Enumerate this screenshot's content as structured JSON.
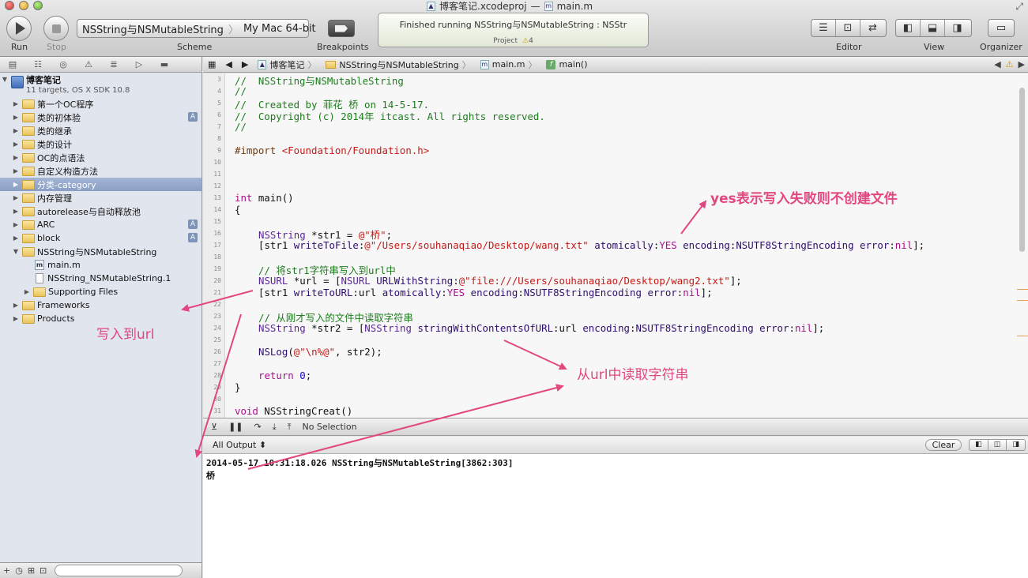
{
  "window": {
    "project_file": "博客笔记.xcodeproj",
    "separator": "—",
    "file_badge": "m",
    "file_name": "main.m",
    "fullscreen_glyph": "⤢"
  },
  "toolbar": {
    "run_label": "Run",
    "stop_label": "Stop",
    "scheme_label": "Scheme",
    "breakpoints_label": "Breakpoints",
    "editor_label": "Editor",
    "view_label": "View",
    "organizer_label": "Organizer",
    "scheme_target": "NSString与NSMutableString",
    "scheme_sep": "〉",
    "scheme_device": "My Mac 64-bit"
  },
  "activity": {
    "status": "Finished running NSString与NSMutableString : NSStr",
    "project_label": "Project",
    "warning_glyph": "⚠",
    "warning_count": "4"
  },
  "navigator": {
    "project_name": "博客笔记",
    "project_subtitle": "11 targets, OS X SDK 10.8",
    "badge": "A",
    "items": [
      {
        "label": "第一个OC程序"
      },
      {
        "label": "类的初体验"
      },
      {
        "label": "类的继承"
      },
      {
        "label": "类的设计"
      },
      {
        "label": "OC的点语法"
      },
      {
        "label": "自定义构造方法"
      },
      {
        "label": "分类-category"
      },
      {
        "label": "内存管理"
      },
      {
        "label": "autorelease与自动释放池"
      },
      {
        "label": "ARC"
      },
      {
        "label": "block"
      },
      {
        "label": "NSString与NSMutableString"
      },
      {
        "label": "main.m"
      },
      {
        "label": "NSString_NSMutableString.1"
      },
      {
        "label": "Supporting Files"
      },
      {
        "label": "Frameworks"
      },
      {
        "label": "Products"
      }
    ]
  },
  "jumpbar": {
    "project": "博客笔记",
    "folder": "NSString与NSMutableString",
    "file_badge": "m",
    "file": "main.m",
    "func_badge": "f",
    "func": "main()",
    "sep": "〉"
  },
  "code": {
    "line_numbers": [
      "3",
      "4",
      "5",
      "6",
      "7",
      "8",
      "9",
      "10",
      "11",
      "12",
      "13",
      "14",
      "15",
      "16",
      "17",
      "18",
      "19",
      "20",
      "21",
      "22",
      "23",
      "24",
      "25",
      "26",
      "27",
      "28",
      "29",
      "30",
      "31"
    ],
    "l3": "//  NSString与NSMutableString",
    "l4": "//",
    "l5": "//  Created by 菲花 桥 on 14-5-17.",
    "l6": "//  Copyright (c) 2014年 itcast. All rights reserved.",
    "l7": "//",
    "l9_kw": "#import",
    "l9_str": "<Foundation/Foundation.h>",
    "l13_kw": "int",
    "l13_rest": " main()",
    "l14": "{",
    "l16_type": "NSString",
    "l16_mid": " *str1 = ",
    "l16_str": "@\"桥\"",
    "l16_end": ";",
    "l17_a": "[str1 ",
    "l17_m1": "writeToFile",
    "l17_b": ":",
    "l17_str": "@\"/Users/souhanaqiao/Desktop/wang.txt\"",
    "l17_c": " ",
    "l17_m2": "atomically",
    "l17_d": ":",
    "l17_yes": "YES",
    "l17_e": " ",
    "l17_m3": "encoding",
    "l17_f": ":",
    "l17_enc": "NSUTF8StringEncoding",
    "l17_g": " ",
    "l17_m4": "error",
    "l17_h": ":",
    "l17_nil": "nil",
    "l17_i": "];",
    "l19": "// 将str1字符串写入到url中",
    "l20_type": "NSURL",
    "l20_mid": " *url = [",
    "l20_type2": "NSURL",
    "l20_sp": " ",
    "l20_m": "URLWithString",
    "l20_col": ":",
    "l20_str": "@\"file:///Users/souhanaqiao/Desktop/wang2.txt\"",
    "l20_end": "];",
    "l21_a": "[str1 ",
    "l21_m1": "writeToURL",
    "l21_b": ":url ",
    "l21_m2": "atomically",
    "l21_c": ":",
    "l21_yes": "YES",
    "l21_d": " ",
    "l21_m3": "encoding",
    "l21_e": ":",
    "l21_enc": "NSUTF8StringEncoding",
    "l21_f": " ",
    "l21_m4": "error",
    "l21_g": ":",
    "l21_nil": "nil",
    "l21_h": "];",
    "l23": "// 从刚才写入的文件中读取字符串",
    "l24_type": "NSString",
    "l24_mid": " *str2 = [",
    "l24_type2": "NSString",
    "l24_sp": " ",
    "l24_m1": "stringWithContentsOfURL",
    "l24_b": ":url ",
    "l24_m2": "encoding",
    "l24_c": ":",
    "l24_enc": "NSUTF8StringEncoding",
    "l24_d": " ",
    "l24_m3": "error",
    "l24_e": ":",
    "l24_nil": "nil",
    "l24_f": "];",
    "l26_fn": "NSLog",
    "l26_a": "(",
    "l26_str": "@\"\\n%@\"",
    "l26_b": ", str2);",
    "l28_kw": "return",
    "l28_sp": " ",
    "l28_num": "0",
    "l28_end": ";",
    "l29": "}",
    "l31_kw": "void",
    "l31_rest": " NSStringCreat()"
  },
  "debug": {
    "selection": "No Selection"
  },
  "console": {
    "output_select": "All Output ⬍",
    "clear_label": "Clear",
    "line1": "2014-05-17 10:31:18.026 NSString与NSMutableString[3862:303]",
    "line2": "桥"
  },
  "annotations": {
    "yes_note": "yes表示写入失败则不创建文件",
    "write_note": "写入到url",
    "read_note": "从url中读取字符串",
    "color": "#e2477f"
  }
}
